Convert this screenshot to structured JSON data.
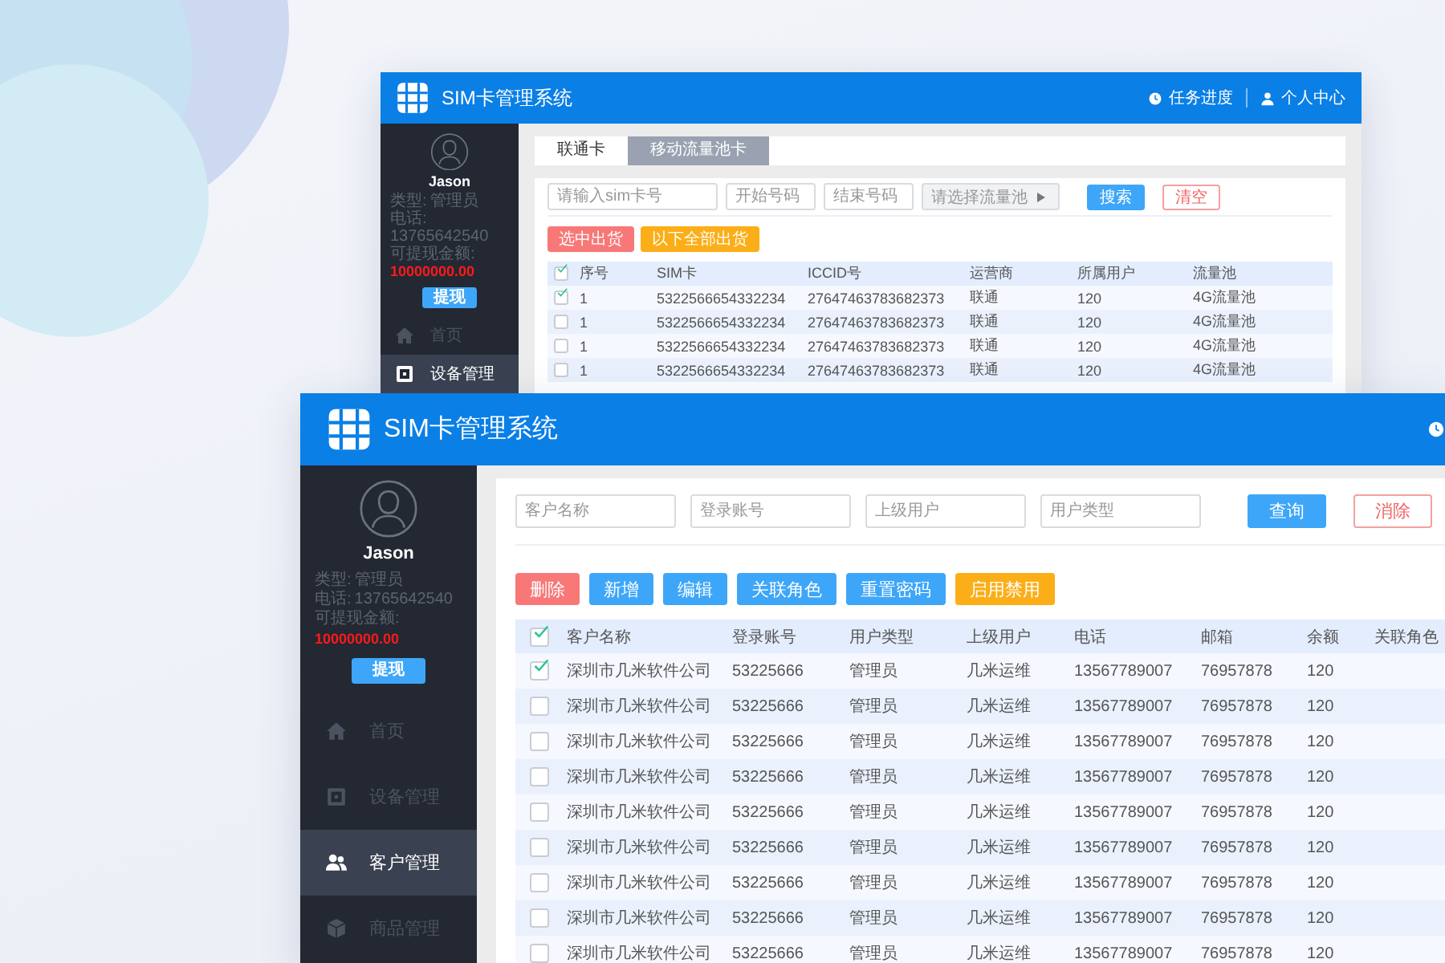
{
  "back_window": {
    "title": "SIM卡管理系统",
    "header_links": [
      {
        "kind": "clock",
        "label": "任务进度"
      },
      {
        "kind": "user",
        "label": "个人中心"
      }
    ],
    "sidebar": {
      "user_name": "Jason",
      "info": [
        {
          "label": "类型:",
          "value": "管理员",
          "highlight": false
        },
        {
          "label": "电话:",
          "value": "13765642540",
          "highlight": false
        },
        {
          "label": "可提现金额:",
          "value": "10000000.00",
          "highlight": true
        }
      ],
      "withdraw_button": "提现",
      "nav": [
        {
          "kind": "home",
          "label": "首页",
          "selected": false
        },
        {
          "kind": "device",
          "label": "设备管理",
          "selected": true
        }
      ]
    },
    "tabs": [
      {
        "label": "联通卡",
        "selected": false
      },
      {
        "label": "移动流量池卡",
        "selected": true
      }
    ],
    "filters": [
      {
        "kind": "input",
        "placeholder": "请输入sim卡号"
      },
      {
        "kind": "input",
        "placeholder": "开始号码"
      },
      {
        "kind": "input",
        "placeholder": "结束号码"
      },
      {
        "kind": "select",
        "placeholder": "请选择流量池"
      }
    ],
    "search_button": "搜索",
    "clear_button": "清空",
    "actions": [
      {
        "kind": "danger",
        "label": "选中出货"
      },
      {
        "kind": "warning",
        "label": "以下全部出货"
      }
    ],
    "table": {
      "header_checked": true,
      "columns": [
        "序号",
        "SIM卡",
        "ICCID号",
        "运营商",
        "所属用户",
        "流量池"
      ],
      "rows": [
        {
          "checked": true,
          "cells": [
            "1",
            "5322566654332234",
            "27647463783682373",
            "联通",
            "120",
            "4G流量池"
          ]
        },
        {
          "checked": false,
          "cells": [
            "1",
            "5322566654332234",
            "27647463783682373",
            "联通",
            "120",
            "4G流量池"
          ]
        },
        {
          "checked": false,
          "cells": [
            "1",
            "5322566654332234",
            "27647463783682373",
            "联通",
            "120",
            "4G流量池"
          ]
        },
        {
          "checked": false,
          "cells": [
            "1",
            "5322566654332234",
            "27647463783682373",
            "联通",
            "120",
            "4G流量池"
          ]
        }
      ]
    }
  },
  "front_window": {
    "title": "SIM卡管理系统",
    "header_links": [
      {
        "kind": "clock"
      }
    ],
    "sidebar": {
      "user_name": "Jason",
      "info": [
        {
          "label": "类型:",
          "value": "管理员",
          "highlight": false
        },
        {
          "label": "电话:",
          "value": "13765642540",
          "highlight": false
        },
        {
          "label": "可提现金额:",
          "value": "10000000.00",
          "highlight": true
        }
      ],
      "withdraw_button": "提现",
      "nav": [
        {
          "kind": "home",
          "label": "首页",
          "selected": false
        },
        {
          "kind": "device",
          "label": "设备管理",
          "selected": false
        },
        {
          "kind": "people",
          "label": "客户管理",
          "selected": true
        },
        {
          "kind": "cube",
          "label": "商品管理",
          "selected": false
        }
      ]
    },
    "filters": [
      {
        "kind": "input",
        "placeholder": "客户名称"
      },
      {
        "kind": "input",
        "placeholder": "登录账号"
      },
      {
        "kind": "input",
        "placeholder": "上级用户"
      },
      {
        "kind": "input",
        "placeholder": "用户类型"
      }
    ],
    "search_button": "查询",
    "clear_button": "消除",
    "actions": [
      {
        "kind": "danger",
        "label": "删除"
      },
      {
        "kind": "primary",
        "label": "新增"
      },
      {
        "kind": "primary",
        "label": "编辑"
      },
      {
        "kind": "primary",
        "label": "关联角色"
      },
      {
        "kind": "primary",
        "label": "重置密码"
      },
      {
        "kind": "warning",
        "label": "启用禁用"
      }
    ],
    "table": {
      "header_checked": true,
      "columns": [
        "客户名称",
        "登录账号",
        "用户类型",
        "上级用户",
        "电话",
        "邮箱",
        "余额",
        "关联角色"
      ],
      "rows": [
        {
          "checked": true,
          "cells": [
            "深圳市几米软件公司",
            "53225666",
            "管理员",
            "几米运维",
            "13567789007",
            "76957878",
            "120"
          ]
        },
        {
          "checked": false,
          "cells": [
            "深圳市几米软件公司",
            "53225666",
            "管理员",
            "几米运维",
            "13567789007",
            "76957878",
            "120"
          ]
        },
        {
          "checked": false,
          "cells": [
            "深圳市几米软件公司",
            "53225666",
            "管理员",
            "几米运维",
            "13567789007",
            "76957878",
            "120"
          ]
        },
        {
          "checked": false,
          "cells": [
            "深圳市几米软件公司",
            "53225666",
            "管理员",
            "几米运维",
            "13567789007",
            "76957878",
            "120"
          ]
        },
        {
          "checked": false,
          "cells": [
            "深圳市几米软件公司",
            "53225666",
            "管理员",
            "几米运维",
            "13567789007",
            "76957878",
            "120"
          ]
        },
        {
          "checked": false,
          "cells": [
            "深圳市几米软件公司",
            "53225666",
            "管理员",
            "几米运维",
            "13567789007",
            "76957878",
            "120"
          ]
        },
        {
          "checked": false,
          "cells": [
            "深圳市几米软件公司",
            "53225666",
            "管理员",
            "几米运维",
            "13567789007",
            "76957878",
            "120"
          ]
        },
        {
          "checked": false,
          "cells": [
            "深圳市几米软件公司",
            "53225666",
            "管理员",
            "几米运维",
            "13567789007",
            "76957878",
            "120"
          ]
        },
        {
          "checked": false,
          "cells": [
            "深圳市几米软件公司",
            "53225666",
            "管理员",
            "几米运维",
            "13567789007",
            "76957878",
            "120"
          ]
        }
      ]
    }
  }
}
